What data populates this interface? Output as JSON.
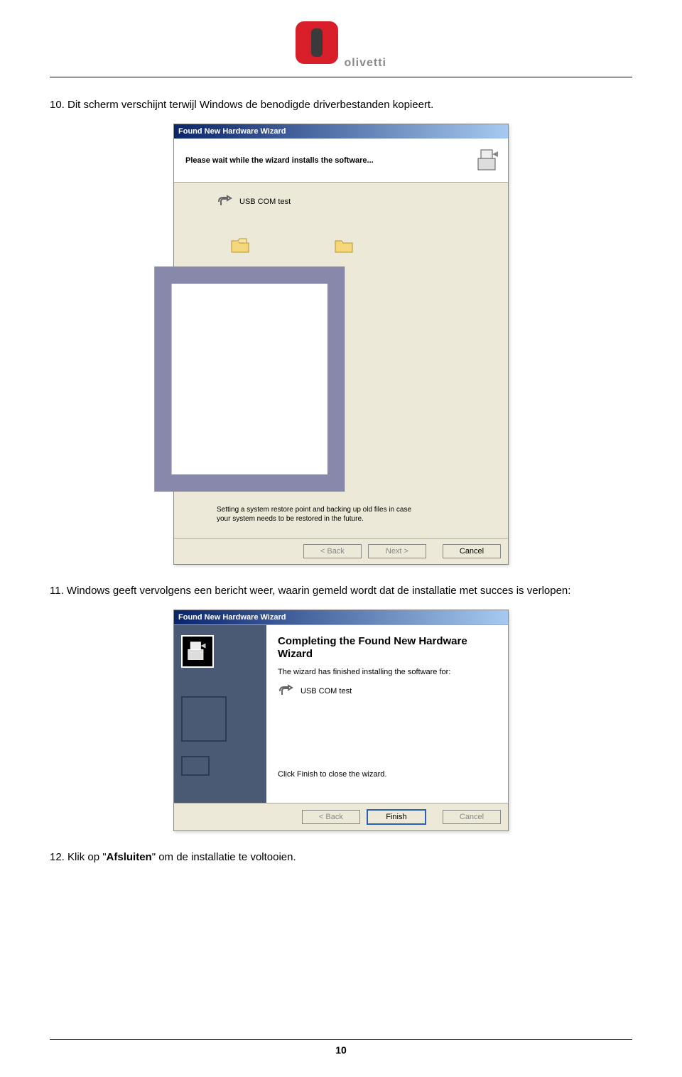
{
  "logo_text": "olivetti",
  "step10": "10. Dit scherm verschijnt terwijl Windows de benodigde driverbestanden kopieert.",
  "step11": "11. Windows geeft vervolgens een bericht weer, waarin gemeld wordt dat de installatie met succes is verlopen:",
  "step12_prefix": "12. Klik op \"",
  "step12_bold": "Afsluiten",
  "step12_suffix": "\" om de installatie te voltooien.",
  "page_number": "10",
  "wizard1": {
    "title": "Found New Hardware Wizard",
    "header": "Please wait while the wizard installs the software...",
    "device": "USB COM test",
    "restore_text": "Setting a system restore point and backing up old files in case your system needs to be restored in the future.",
    "back": "< Back",
    "next": "Next >",
    "cancel": "Cancel"
  },
  "wizard2": {
    "title": "Found New Hardware Wizard",
    "heading": "Completing the Found New Hardware Wizard",
    "sub": "The wizard has finished installing the software for:",
    "device": "USB COM test",
    "finish_note": "Click Finish to close the wizard.",
    "back": "< Back",
    "finish": "Finish",
    "cancel": "Cancel"
  }
}
